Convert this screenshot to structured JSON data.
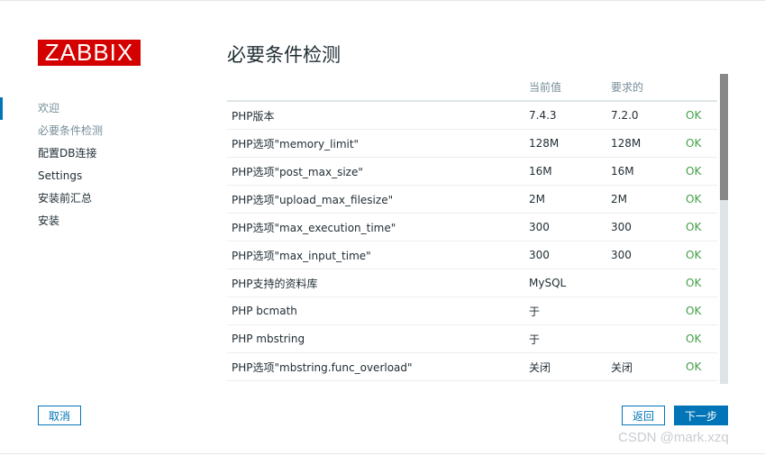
{
  "logo": "ZABBIX",
  "steps": [
    {
      "label": "欢迎",
      "state": "done"
    },
    {
      "label": "必要条件检测",
      "state": "current"
    },
    {
      "label": "配置DB连接",
      "state": "todo"
    },
    {
      "label": "Settings",
      "state": "todo"
    },
    {
      "label": "安装前汇总",
      "state": "todo"
    },
    {
      "label": "安装",
      "state": "todo"
    }
  ],
  "main": {
    "title": "必要条件检测",
    "columns": [
      "",
      "当前值",
      "要求的",
      ""
    ],
    "rows": [
      {
        "name": "PHP版本",
        "current": "7.4.3",
        "required": "7.2.0",
        "status": "OK"
      },
      {
        "name": "PHP选项\"memory_limit\"",
        "current": "128M",
        "required": "128M",
        "status": "OK"
      },
      {
        "name": "PHP选项\"post_max_size\"",
        "current": "16M",
        "required": "16M",
        "status": "OK"
      },
      {
        "name": "PHP选项\"upload_max_filesize\"",
        "current": "2M",
        "required": "2M",
        "status": "OK"
      },
      {
        "name": "PHP选项\"max_execution_time\"",
        "current": "300",
        "required": "300",
        "status": "OK"
      },
      {
        "name": "PHP选项\"max_input_time\"",
        "current": "300",
        "required": "300",
        "status": "OK"
      },
      {
        "name": "PHP支持的资料库",
        "current": "MySQL",
        "required": "",
        "status": "OK"
      },
      {
        "name": "PHP bcmath",
        "current": "于",
        "required": "",
        "status": "OK"
      },
      {
        "name": "PHP mbstring",
        "current": "于",
        "required": "",
        "status": "OK"
      },
      {
        "name": "PHP选项\"mbstring.func_overload\"",
        "current": "关闭",
        "required": "关闭",
        "status": "OK"
      },
      {
        "name": "",
        "current": "",
        "required": "",
        "status": ""
      }
    ]
  },
  "buttons": {
    "cancel": "取消",
    "back": "返回",
    "next": "下一步"
  },
  "watermark": "CSDN @mark.xzq",
  "colors": {
    "brand": "#d40000",
    "accent": "#0275b8",
    "ok": "#429e47"
  }
}
